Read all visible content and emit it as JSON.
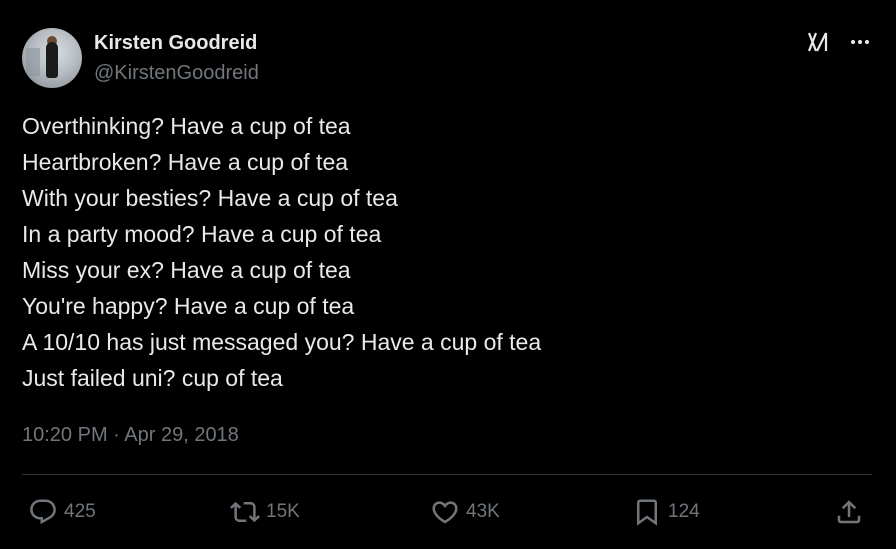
{
  "author": {
    "name": "Kirsten Goodreid",
    "handle": "@KirstenGoodreid"
  },
  "header_icons": [
    "grok-icon",
    "more-options-icon"
  ],
  "tweet": {
    "lines": [
      "Overthinking? Have a cup of tea",
      "Heartbroken? Have a cup of tea",
      "With your besties? Have a cup of tea",
      "In a party mood? Have a cup of tea",
      "Miss your ex? Have a cup of tea",
      "You're happy? Have a cup of tea",
      "A 10/10 has just messaged you? Have a cup of tea",
      "Just failed uni? cup of tea"
    ],
    "timestamp": "10:20 PM · Apr 29, 2018"
  },
  "actions": {
    "replies": "425",
    "reposts": "15K",
    "likes": "43K",
    "bookmarks": "124"
  },
  "colors": {
    "background": "#000000",
    "primary_text": "#e7e9ea",
    "secondary_text": "#71767b",
    "divider": "#2f3336"
  }
}
